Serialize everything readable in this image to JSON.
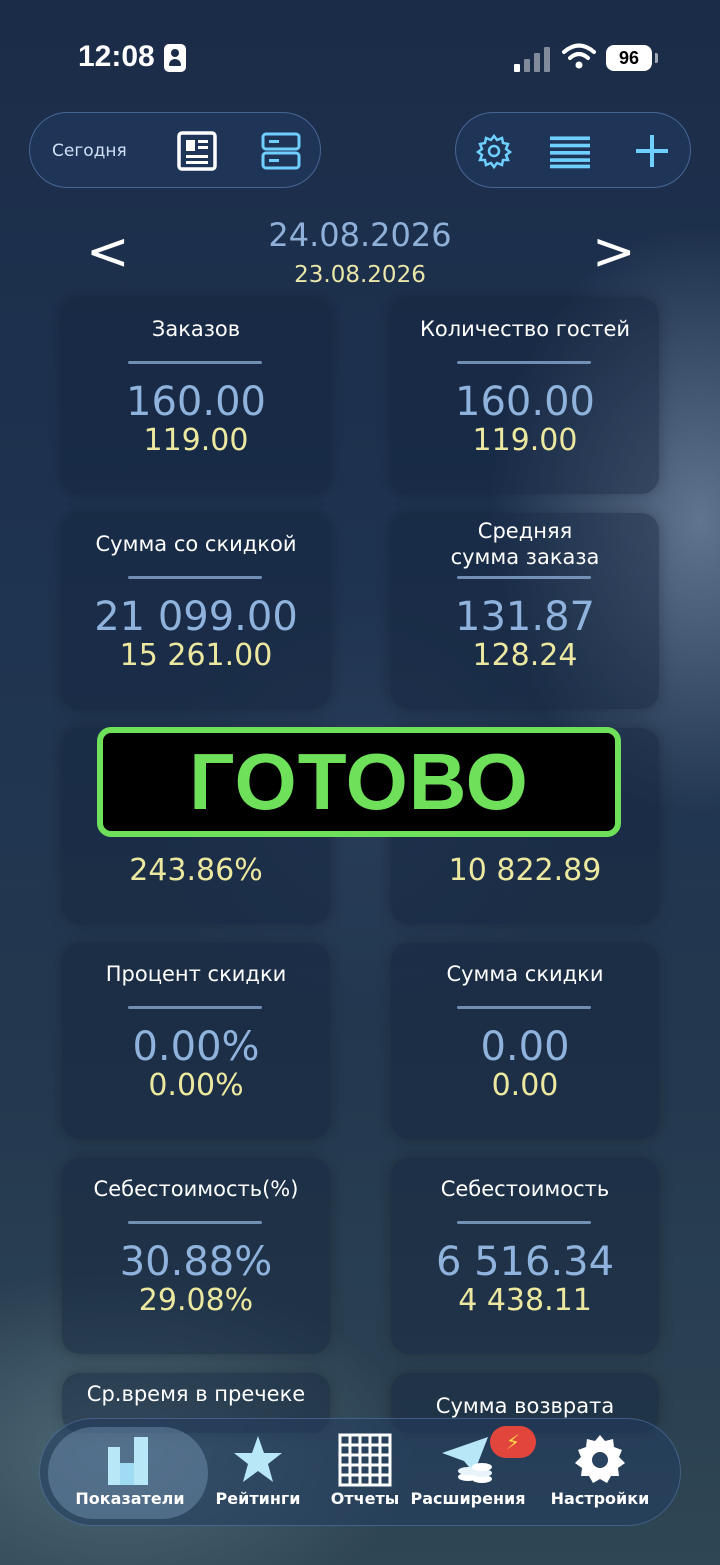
{
  "status_bar": {
    "time": "12:08",
    "battery": "96"
  },
  "toolbar": {
    "today_label": "Сегодня",
    "icons": [
      "news-icon",
      "server-icon",
      "gear-icon",
      "list-icon",
      "plus-icon"
    ]
  },
  "date_nav": {
    "prev": "<",
    "next": ">",
    "current": "24.08.2026",
    "compare": "23.08.2026"
  },
  "cards": [
    {
      "label": "Заказов",
      "value": "160.00",
      "compare": "119.00"
    },
    {
      "label": "Количество гостей",
      "value": "160.00",
      "compare": "119.00"
    },
    {
      "label": "Сумма со скидкой",
      "value": "21 099.00",
      "compare": "15 261.00"
    },
    {
      "label": "Средняя\nсумма заказа",
      "value": "131.87",
      "compare": "128.24"
    },
    {
      "label": "",
      "value": "",
      "compare": "243.86%"
    },
    {
      "label": "",
      "value": "",
      "compare": "10 822.89"
    },
    {
      "label": "Процент скидки",
      "value": "0.00%",
      "compare": "0.00%"
    },
    {
      "label": "Сумма скидки",
      "value": "0.00",
      "compare": "0.00"
    },
    {
      "label": "Себестоимость(%)",
      "value": "30.88%",
      "compare": "29.08%"
    },
    {
      "label": "Себестоимость",
      "value": "6 516.34",
      "compare": "4 438.11"
    },
    {
      "label": "Ср.время в пречеке",
      "value": "",
      "compare": ""
    },
    {
      "label": "Сумма возврата",
      "value": "",
      "compare": ""
    }
  ],
  "overlay": {
    "text": "ГОТОВО"
  },
  "tabbar": {
    "active": 0,
    "tabs": [
      {
        "label": "Показатели",
        "icon": "bars-chart-icon"
      },
      {
        "label": "Рейтинги",
        "icon": "star-icon"
      },
      {
        "label": "Отчеты",
        "icon": "grid-icon"
      },
      {
        "label": "Расширения",
        "icon": "paper-plane-coins-icon"
      },
      {
        "label": "Настройки",
        "icon": "gear-icon"
      }
    ],
    "badge": "⚡"
  },
  "colors": {
    "accent_value": "#8fb3dc",
    "compare_value": "#ece8a0",
    "overlay_green": "#6ee05a"
  }
}
